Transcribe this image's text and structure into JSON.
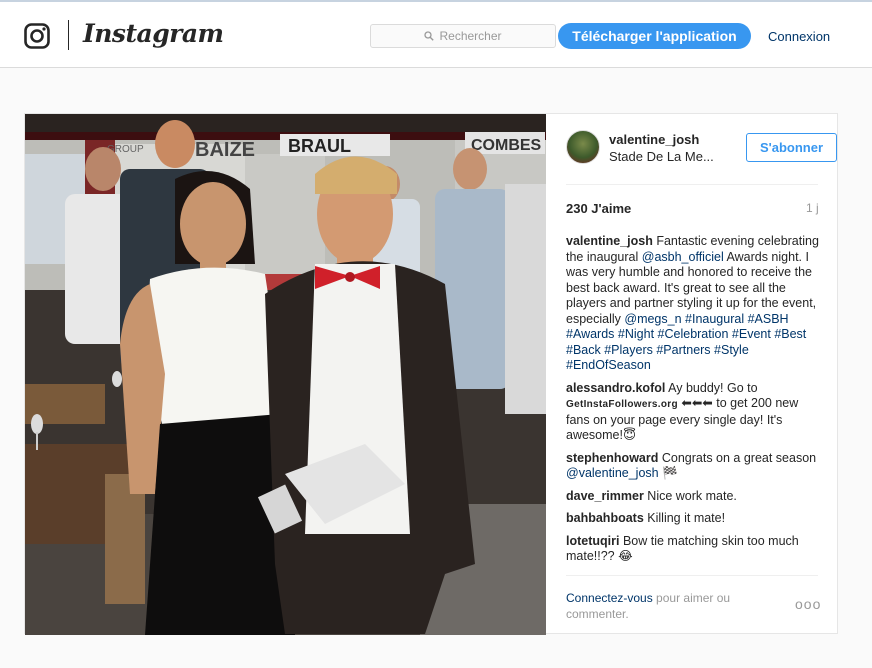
{
  "header": {
    "brand": "Instagram",
    "search_placeholder": "Rechercher",
    "download_label": "Télécharger l'application",
    "login_label": "Connexion"
  },
  "post": {
    "username": "valentine_josh",
    "location": "Stade De La Me...",
    "follow_label": "S'abonner",
    "likes": "230 J'aime",
    "time": "1 j",
    "caption": {
      "user": "valentine_josh",
      "text_1": " Fantastic evening celebrating the inaugural ",
      "mention_1": "@asbh_officiel",
      "text_2": " Awards night. I was very humble and honored to receive the best back award. It's great to see all the players and partner styling it up for the event, especially ",
      "mention_2": "@megs_n",
      "hashtags": [
        "#Inaugural",
        "#ASBH",
        "#Awards",
        "#Night",
        "#Celebration",
        "#Event",
        "#Best",
        "#Back",
        "#Players",
        "#Partners",
        "#Style",
        "#EndOfSeason"
      ]
    },
    "comments": [
      {
        "user": "alessandro.kofol",
        "text_1": " Ay buddy! Go to ",
        "smallcaps": "GetInstaFollowers.org",
        "text_2": " ⬅⬅⬅ to get 200 new fans on your page every single day! It's awesome!😇"
      },
      {
        "user": "stephenhoward",
        "text_1": "  Congrats on a great season ",
        "mention": "@valentine_josh",
        "text_2": " 🏁"
      },
      {
        "user": "dave_rimmer",
        "text_1": " Nice work mate."
      },
      {
        "user": "bahbahboats",
        "text_1": " Killing it mate!"
      },
      {
        "user": "lotetuqiri",
        "text_1": " Bow tie matching skin too much mate!!?? 😂"
      }
    ],
    "footer": {
      "login_link": "Connectez-vous",
      "rest": " pour aimer ou commenter.",
      "more": "ooo"
    },
    "photo_signs": [
      "BRAUL",
      "COMBES",
      "GROUP",
      "BAIZE"
    ]
  },
  "colors": {
    "accent": "#3897f0",
    "link": "#003569",
    "muted": "#999999",
    "bowtie": "#d0202a"
  }
}
